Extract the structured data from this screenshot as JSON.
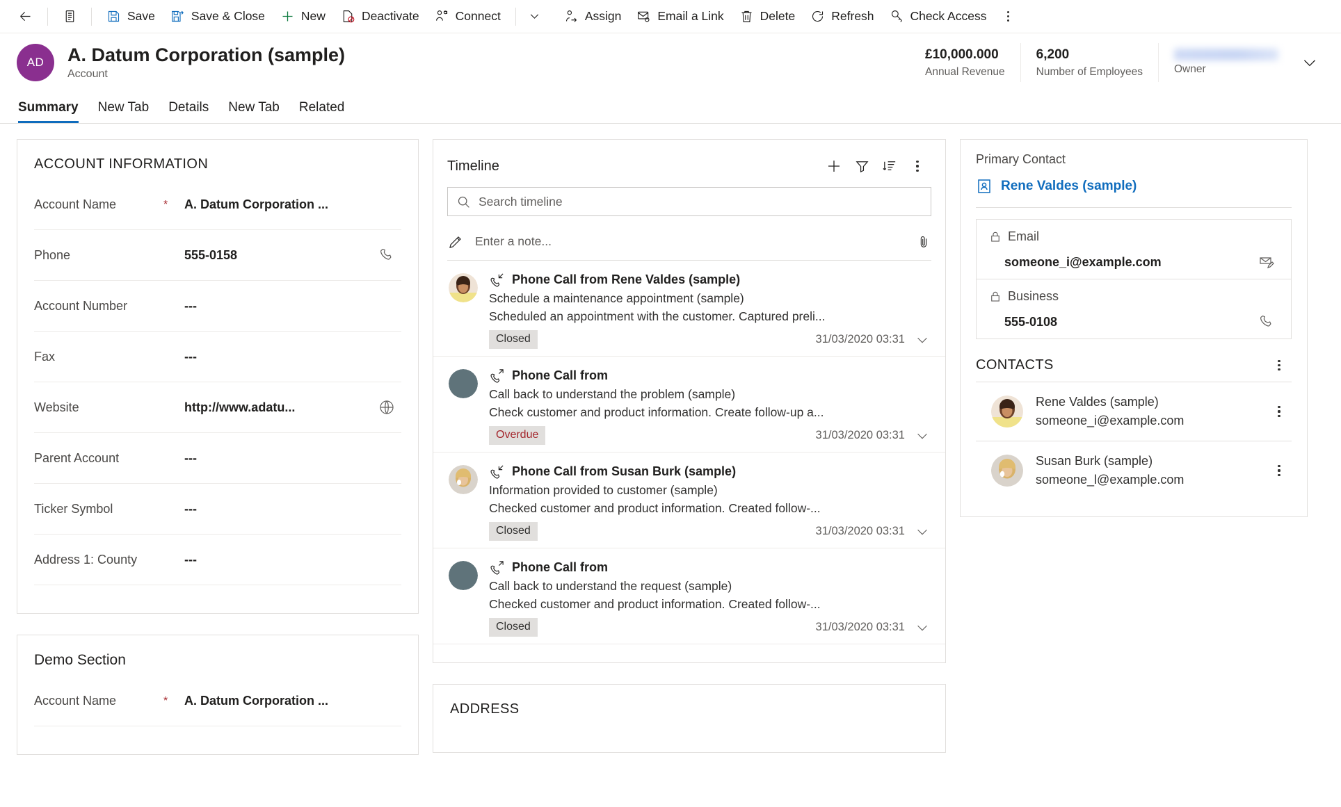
{
  "commandbar": {
    "back_icon": "back-arrow-icon",
    "form_selector_icon": "form-list-icon",
    "items": [
      {
        "label": "Save",
        "icon": "save-icon"
      },
      {
        "label": "Save & Close",
        "icon": "save-and-close-icon"
      },
      {
        "label": "New",
        "icon": "plus-icon"
      },
      {
        "label": "Deactivate",
        "icon": "deactivate-icon"
      },
      {
        "label": "Connect",
        "icon": "connect-icon"
      }
    ],
    "connect_dropdown_icon": "chevron-down-icon",
    "items2": [
      {
        "label": "Assign",
        "icon": "assign-user-icon"
      },
      {
        "label": "Email a Link",
        "icon": "email-link-icon"
      },
      {
        "label": "Delete",
        "icon": "trash-icon"
      },
      {
        "label": "Refresh",
        "icon": "refresh-icon"
      },
      {
        "label": "Check Access",
        "icon": "key-icon"
      }
    ],
    "overflow_label": "more-commands-icon"
  },
  "record_header": {
    "avatar_initials": "AD",
    "title": "A. Datum Corporation (sample)",
    "entity": "Account",
    "fields": [
      {
        "value": "£10,000.000",
        "label": "Annual Revenue"
      },
      {
        "value": "6,200",
        "label": "Number of Employees"
      },
      {
        "value": "",
        "label": "Owner",
        "redacted": true
      }
    ],
    "expand_icon": "chevron-down-icon"
  },
  "tabs": [
    {
      "label": "Summary",
      "active": true
    },
    {
      "label": "New Tab",
      "active": false
    },
    {
      "label": "Details",
      "active": false
    },
    {
      "label": "New Tab",
      "active": false
    },
    {
      "label": "Related",
      "active": false
    }
  ],
  "account_information": {
    "title": "ACCOUNT INFORMATION",
    "rows": [
      {
        "label": "Account Name",
        "required": "*",
        "value": "A. Datum Corporation ...",
        "icon": ""
      },
      {
        "label": "Phone",
        "required": "",
        "value": "555-0158",
        "icon": "phone-icon"
      },
      {
        "label": "Account Number",
        "required": "",
        "value": "---",
        "icon": ""
      },
      {
        "label": "Fax",
        "required": "",
        "value": "---",
        "icon": ""
      },
      {
        "label": "Website",
        "required": "",
        "value": "http://www.adatu...",
        "icon": "globe-icon"
      },
      {
        "label": "Parent Account",
        "required": "",
        "value": "---",
        "icon": ""
      },
      {
        "label": "Ticker Symbol",
        "required": "",
        "value": "---",
        "icon": ""
      },
      {
        "label": "Address 1: County",
        "required": "",
        "value": "---",
        "icon": ""
      }
    ]
  },
  "demo_section": {
    "title": "Demo Section",
    "rows": [
      {
        "label": "Account Name",
        "required": "*",
        "value": "A. Datum Corporation ...",
        "icon": ""
      }
    ]
  },
  "timeline": {
    "title": "Timeline",
    "actions": [
      {
        "name": "create-timeline-record-icon"
      },
      {
        "name": "filter-icon"
      },
      {
        "name": "sort-icon"
      },
      {
        "name": "more-options-icon"
      }
    ],
    "search_placeholder": "Search timeline",
    "search_value": "",
    "search_icon": "search-icon",
    "note_placeholder": "Enter a note...",
    "note_value": "",
    "note_icon": "pencil-icon",
    "attach_icon": "paperclip-icon",
    "items": [
      {
        "subject": "Phone Call from Rene Valdes (sample)",
        "title": "Schedule a maintenance appointment (sample)",
        "description": "Scheduled an appointment with the customer. Captured preli...",
        "badge": "Closed",
        "badge_kind": "closed",
        "date": "31/03/2020 03:31",
        "call_direction": "incoming",
        "avatar": "photo-rene-valdes"
      },
      {
        "subject": "Phone Call from",
        "title": "Call back to understand the problem (sample)",
        "description": "Check customer and product information. Create follow-up a...",
        "badge": "Overdue",
        "badge_kind": "overdue",
        "date": "31/03/2020 03:31",
        "call_direction": "outgoing",
        "avatar": "placeholder"
      },
      {
        "subject": "Phone Call from Susan Burk (sample)",
        "title": "Information provided to customer (sample)",
        "description": "Checked customer and product information. Created follow-...",
        "badge": "Closed",
        "badge_kind": "closed",
        "date": "31/03/2020 03:31",
        "call_direction": "incoming",
        "avatar": "photo-susan-burk"
      },
      {
        "subject": "Phone Call from",
        "title": "Call back to understand the request (sample)",
        "description": "Checked customer and product information. Created follow-...",
        "badge": "Closed",
        "badge_kind": "closed",
        "date": "31/03/2020 03:31",
        "call_direction": "outgoing",
        "avatar": "placeholder"
      }
    ]
  },
  "address_card": {
    "title": "ADDRESS"
  },
  "right_panel": {
    "primary_contact_label": "Primary Contact",
    "primary_contact_name": "Rene Valdes (sample)",
    "primary_contact_icon": "contact-card-icon",
    "fields": [
      {
        "label": "Email",
        "value": "someone_i@example.com",
        "lock_icon": "lock-icon",
        "action_icon": "compose-email-icon"
      },
      {
        "label": "Business",
        "value": "555-0108",
        "lock_icon": "lock-icon",
        "action_icon": "phone-icon"
      }
    ],
    "contacts_title": "CONTACTS",
    "contacts_more_icon": "more-options-icon",
    "contacts": [
      {
        "name": "Rene Valdes (sample)",
        "email": "someone_i@example.com",
        "avatar": "photo-rene-valdes",
        "more_icon": "more-options-icon"
      },
      {
        "name": "Susan Burk (sample)",
        "email": "someone_l@example.com",
        "avatar": "photo-susan-burk",
        "more_icon": "more-options-icon"
      }
    ]
  },
  "colors": {
    "accent": "#0f6cbd",
    "avatar_purple": "#8a2f8f",
    "required_red": "#a4262c",
    "overdue_red": "#a4262c",
    "badge_bg": "#e1dfdd"
  }
}
